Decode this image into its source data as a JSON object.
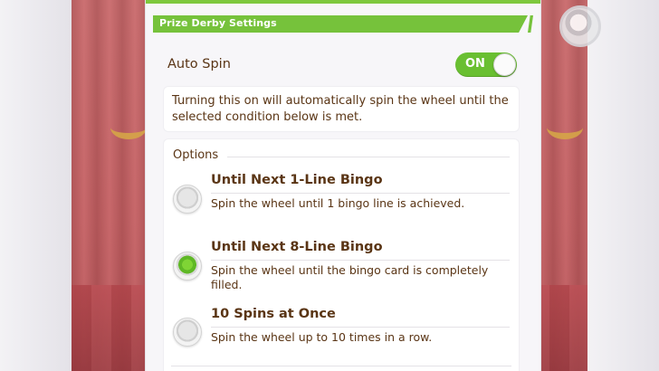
{
  "section": {
    "title": "Prize Derby Settings"
  },
  "auto_spin": {
    "label": "Auto Spin",
    "toggle_text": "ON",
    "enabled": true
  },
  "description": "Turning this on will automatically spin the wheel until the selected condition below is met.",
  "options": {
    "title": "Options",
    "items": [
      {
        "title": "Until Next 1-Line Bingo",
        "desc": "Spin the wheel until 1 bingo line is achieved.",
        "selected": false
      },
      {
        "title": "Until Next 8-Line Bingo",
        "desc": "Spin the wheel until the bingo card is completely filled.",
        "selected": true
      },
      {
        "title": "10 Spins at Once",
        "desc": "Spin the wheel up to 10 times in a row.",
        "selected": false
      }
    ]
  },
  "colors": {
    "accent_green": "#76c23b",
    "text_brown": "#5a3515",
    "curtain_red": "#c45e61"
  }
}
